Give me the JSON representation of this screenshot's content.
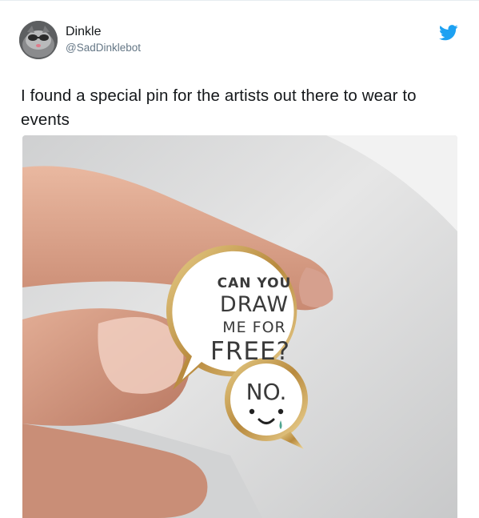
{
  "tweet": {
    "author_name": "Dinkle",
    "author_handle": "@SadDinklebot",
    "text": "I found a special pin for the artists out there to wear to events"
  },
  "media": {
    "pin_text_line1": "CAN YOU",
    "pin_text_line2": "DRAW",
    "pin_text_line3": "ME FOR",
    "pin_text_line4": "FREE?",
    "pin_reply": "NO."
  },
  "icons": {
    "brand": "twitter-bird-icon"
  },
  "colors": {
    "brand": "#1da1f2",
    "text": "#14171a",
    "secondary": "#657786"
  }
}
